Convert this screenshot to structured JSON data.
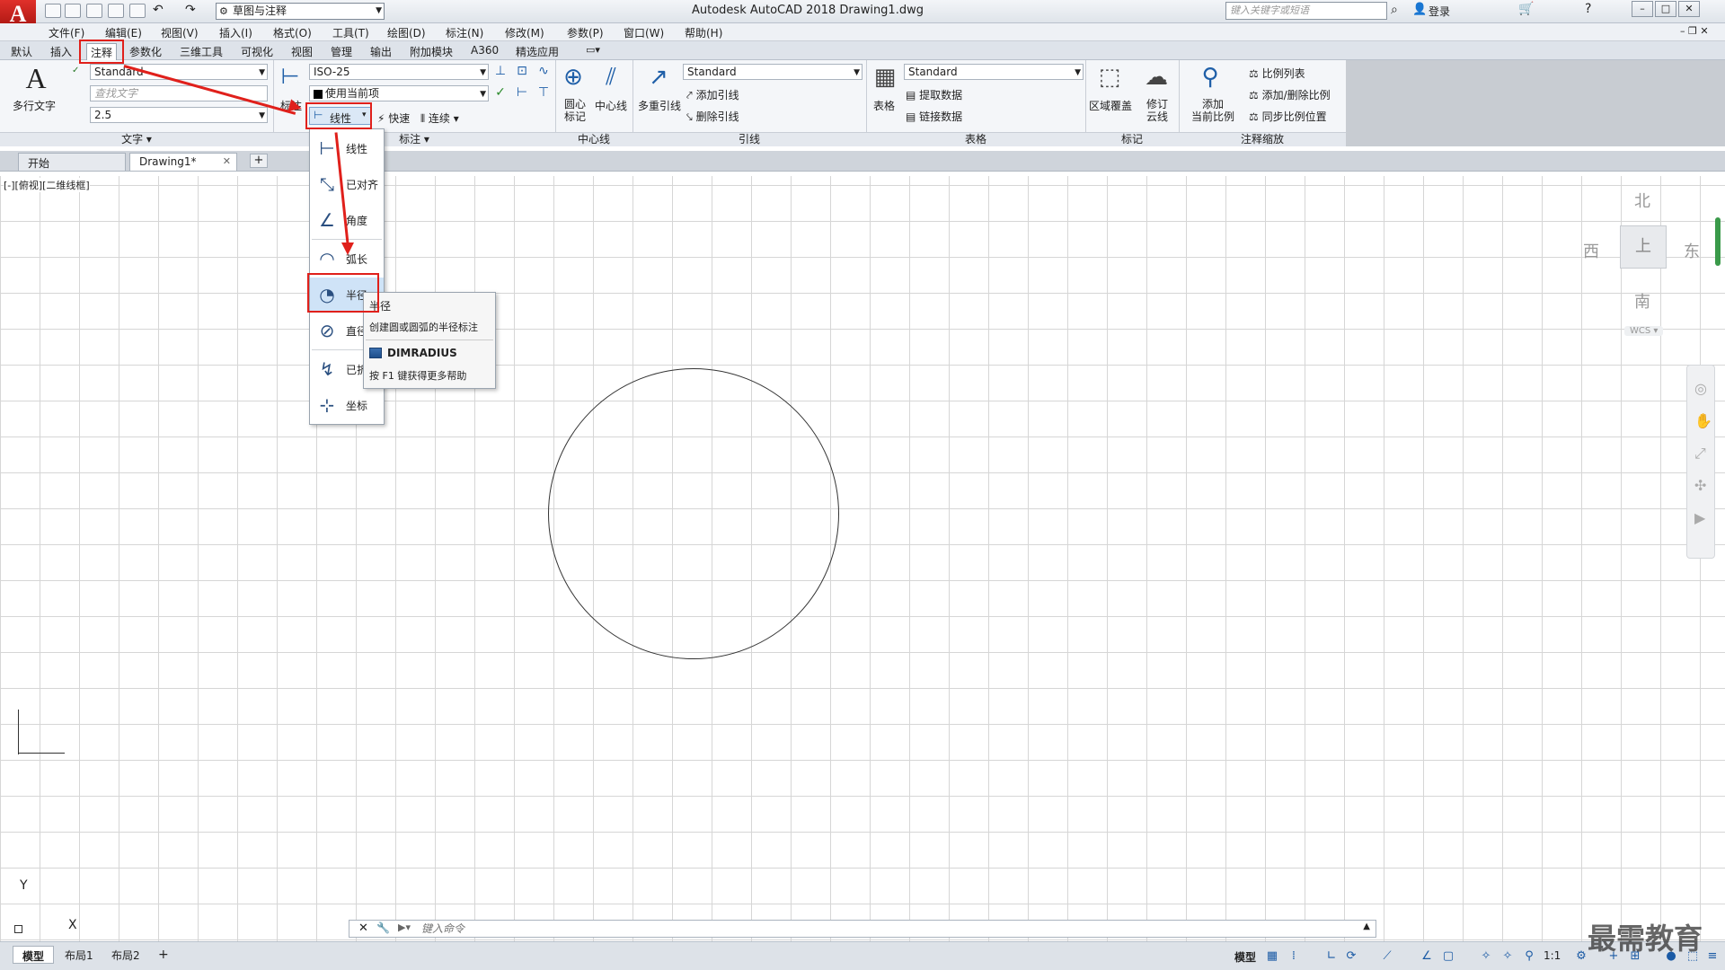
{
  "title_bar": {
    "app_logo": "A",
    "workspace": "草图与注释",
    "window_title": "Autodesk AutoCAD 2018    Drawing1.dwg",
    "search_placeholder": "键入关键字或短语",
    "login": "登录"
  },
  "menu": [
    "文件(F)",
    "编辑(E)",
    "视图(V)",
    "插入(I)",
    "格式(O)",
    "工具(T)",
    "绘图(D)",
    "标注(N)",
    "修改(M)",
    "参数(P)",
    "窗口(W)",
    "帮助(H)"
  ],
  "ribbon_tabs": [
    "默认",
    "插入",
    "注释",
    "参数化",
    "三维工具",
    "可视化",
    "视图",
    "管理",
    "输出",
    "附加模块",
    "A360",
    "精选应用"
  ],
  "active_tab": "注释",
  "panels": {
    "text": {
      "title": "文字",
      "big_button": "多行文字",
      "style": "Standard",
      "find_placeholder": "查找文字",
      "height": "2.5"
    },
    "dimension": {
      "title": "标注",
      "big_button": "标注",
      "style": "ISO-25",
      "layer": "使用当前项",
      "linear": "线性",
      "quick": "快速",
      "continue": "连续"
    },
    "centerline": {
      "title": "中心线",
      "center_mark": "圆心\n标记",
      "centerline": "中心线"
    },
    "leader": {
      "title": "引线",
      "big_button": "多重引线",
      "style": "Standard",
      "add": "添加引线",
      "remove": "删除引线"
    },
    "table": {
      "title": "表格",
      "big_button": "表格",
      "style": "Standard",
      "extract": "提取数据",
      "link": "链接数据"
    },
    "markup": {
      "title": "标记",
      "wipeout": "区域覆盖",
      "revcloud": "修订\n云线"
    },
    "scale": {
      "title": "注释缩放",
      "add_current": "添加\n当前比例",
      "scale_list": "比例列表",
      "add_delete": "添加/删除比例",
      "sync": "同步比例位置"
    }
  },
  "file_tabs": [
    "开始",
    "Drawing1*"
  ],
  "view_label": "[-][俯视][二维线框]",
  "viewcube": {
    "north": "北",
    "south": "南",
    "east": "东",
    "west": "西",
    "wcs": "WCS"
  },
  "dropdown": [
    {
      "label": "线性",
      "icon": "linear-icon"
    },
    {
      "label": "已对齐",
      "icon": "aligned-icon"
    },
    {
      "label": "角度",
      "icon": "angular-icon"
    },
    {
      "label": "弧长",
      "icon": "arc-length-icon"
    },
    {
      "label": "半径",
      "icon": "radius-icon"
    },
    {
      "label": "直径",
      "icon": "diameter-icon"
    },
    {
      "label": "已折",
      "icon": "jogged-icon"
    },
    {
      "label": "坐标",
      "icon": "ordinate-icon"
    }
  ],
  "tooltip": {
    "title": "半径",
    "description": "创建圆或圆弧的半径标注",
    "command": "DIMRADIUS",
    "help": "按 F1 键获得更多帮助"
  },
  "ucs": {
    "x": "X",
    "y": "Y"
  },
  "command_placeholder": "键入命令",
  "layout_tabs": [
    "模型",
    "布局1",
    "布局2"
  ],
  "status": {
    "model": "模型",
    "scale": "1:1"
  },
  "watermark": "最需教育",
  "colors": {
    "highlight_red": "#e0201b",
    "accent_blue": "#1f5fa8"
  }
}
